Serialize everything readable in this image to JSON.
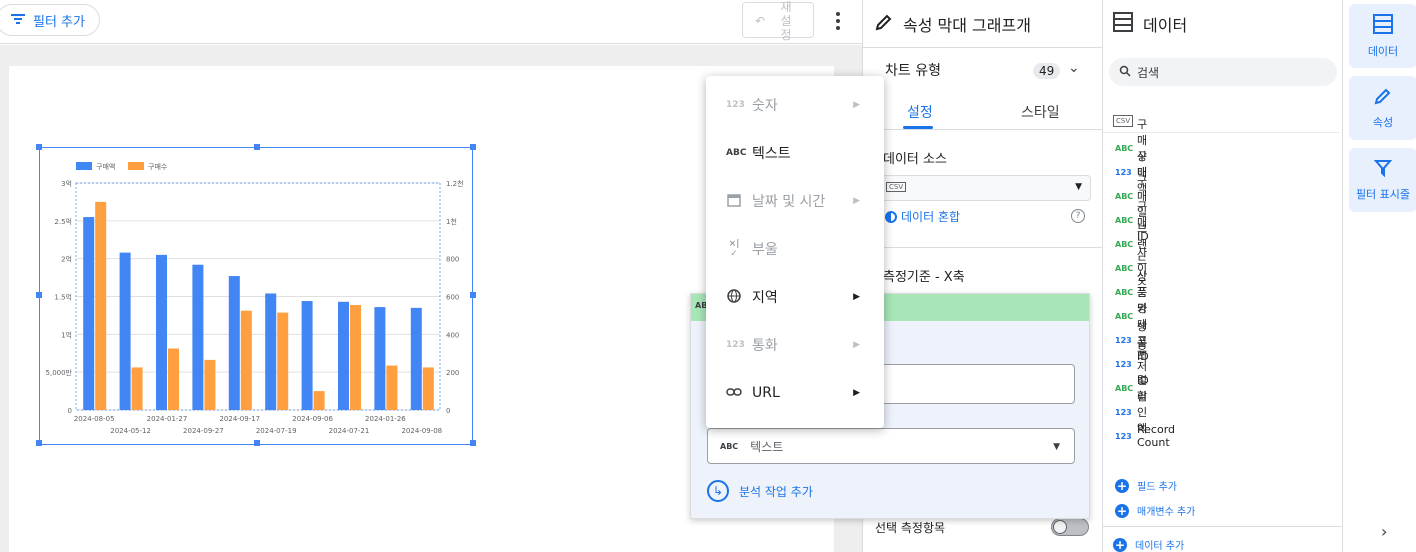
{
  "toolbar": {
    "filter_label": "필터 추가",
    "reset_label": "재설정"
  },
  "chart_data": {
    "type": "bar",
    "categories": [
      "2024-08-05",
      "2024-05-12",
      "2024-01-27",
      "2024-09-27",
      "2024-09-17",
      "2024-07-19",
      "2024-09-06",
      "2024-07-21",
      "2024-01-26",
      "2024-09-08"
    ],
    "x_tick_row1": [
      "2024-08-05",
      "2024-01-27",
      "2024-09-17",
      "2024-09-06",
      "2024-01-26"
    ],
    "x_tick_row2": [
      "2024-05-12",
      "2024-09-27",
      "2024-07-19",
      "2024-07-21",
      "2024-09-08"
    ],
    "series": [
      {
        "name": "구매액",
        "color": "#4285f4",
        "axis": "left",
        "values": [
          2.55,
          2.08,
          2.05,
          1.92,
          1.77,
          1.54,
          1.44,
          1.43,
          1.36,
          1.35
        ]
      },
      {
        "name": "구매수",
        "color": "#ff9f40",
        "axis": "right",
        "values": [
          1100,
          225,
          325,
          265,
          525,
          515,
          100,
          555,
          235,
          225
        ]
      }
    ],
    "y_left": {
      "ticks": [
        "0",
        "5,000만",
        "1억",
        "1.5억",
        "2억",
        "2.5억",
        "3억"
      ],
      "max": 3
    },
    "y_right": {
      "ticks": [
        "0",
        "200",
        "400",
        "600",
        "800",
        "1천",
        "1.2천"
      ],
      "max": 1200
    },
    "grid": true,
    "legend": "top-left"
  },
  "properties": {
    "title": "속성 막대 그래프개",
    "chart_type_label": "차트 유형",
    "chart_type_count": "49",
    "tabs": [
      "설정",
      "스타일"
    ],
    "data_source_label": "데이터 소스",
    "blend_label": "데이터 혼합",
    "dimension_label": "측정기준 - X축",
    "optional_metric_label": "선택 측정항목"
  },
  "dim_editor": {
    "type_value": "텍스트",
    "type_icon": "ABC",
    "add_calc_label": "분석 작업 추가"
  },
  "type_menu": [
    {
      "icon": "123",
      "label": "숫자",
      "disabled": true,
      "submenu": true
    },
    {
      "icon": "ABC",
      "label": "텍스트",
      "disabled": false,
      "submenu": false
    },
    {
      "icon": "calendar-icon",
      "label": "날짜 및 시간",
      "disabled": true,
      "submenu": true
    },
    {
      "icon": "boolean-icon",
      "label": "부울",
      "disabled": true,
      "submenu": false
    },
    {
      "icon": "globe-icon",
      "label": "지역",
      "disabled": false,
      "submenu": true
    },
    {
      "icon": "123",
      "label": "통화",
      "disabled": true,
      "submenu": true
    },
    {
      "icon": "link-icon",
      "label": "URL",
      "disabled": false,
      "submenu": true
    }
  ],
  "data_panel": {
    "title": "데이터",
    "search_placeholder": "검색",
    "csv_label": "CSV",
    "fields": [
      {
        "type": "ABC",
        "name": "구매상태"
      },
      {
        "type": "123",
        "name": "구매액"
      },
      {
        "type": "ABC",
        "name": "구매일"
      },
      {
        "type": "ABC",
        "name": "구매ID"
      },
      {
        "type": "ABC",
        "name": "브랜드"
      },
      {
        "type": "ABC",
        "name": "사이즈"
      },
      {
        "type": "ABC",
        "name": "상품명"
      },
      {
        "type": "ABC",
        "name": "상품카테고리"
      },
      {
        "type": "123",
        "name": "상품ID"
      },
      {
        "type": "123",
        "name": "유저ID"
      },
      {
        "type": "ABC",
        "name": "컬러"
      },
      {
        "type": "123",
        "name": "할인액"
      },
      {
        "type": "123",
        "name": "Record Count"
      }
    ],
    "add_field": "필드 추가",
    "add_param": "매개변수 추가",
    "add_data": "데이터 추가"
  },
  "rail": {
    "data": "데이터",
    "properties": "속성",
    "filter": "필터 표시줄"
  }
}
